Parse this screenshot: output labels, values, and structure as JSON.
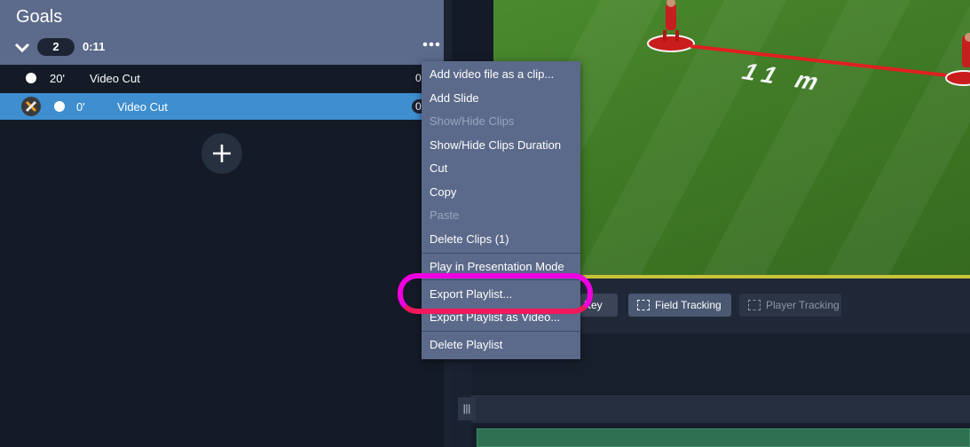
{
  "playlist": {
    "title": "Goals",
    "clip_count": "2",
    "duration": "0:11"
  },
  "clips": [
    {
      "time": "20'",
      "name": "Video Cut",
      "trail": "0"
    },
    {
      "time": "0'",
      "name": "Video Cut",
      "trail": "0"
    }
  ],
  "field": {
    "distance_label": "11 m"
  },
  "toolbar": {
    "key_label": "Key",
    "field_tracking_label": "Field Tracking",
    "player_tracking_label": "Player Tracking"
  },
  "timeline": {
    "handle_glyph": "|||"
  },
  "context_menu": {
    "items": [
      {
        "label": "Add video file as a clip...",
        "enabled": true
      },
      {
        "label": "Add Slide",
        "enabled": true
      },
      {
        "label": "Show/Hide Clips",
        "enabled": false
      },
      {
        "label": "Show/Hide Clips Duration",
        "enabled": true
      },
      {
        "label": "Cut",
        "enabled": true
      },
      {
        "label": "Copy",
        "enabled": true
      },
      {
        "label": "Paste",
        "enabled": false
      },
      {
        "label": "Delete Clips (1)",
        "enabled": true
      },
      {
        "label": "Play in Presentation Mode",
        "enabled": true
      },
      {
        "label": "Export Playlist...",
        "enabled": true
      },
      {
        "label": "Export Playlist as Video...",
        "enabled": true
      },
      {
        "label": "Delete Playlist",
        "enabled": true
      }
    ]
  },
  "colors": {
    "accent_selected_row": "#3e8ed0",
    "menu_background": "#5b698a",
    "highlight_ring": "#f000e0"
  }
}
